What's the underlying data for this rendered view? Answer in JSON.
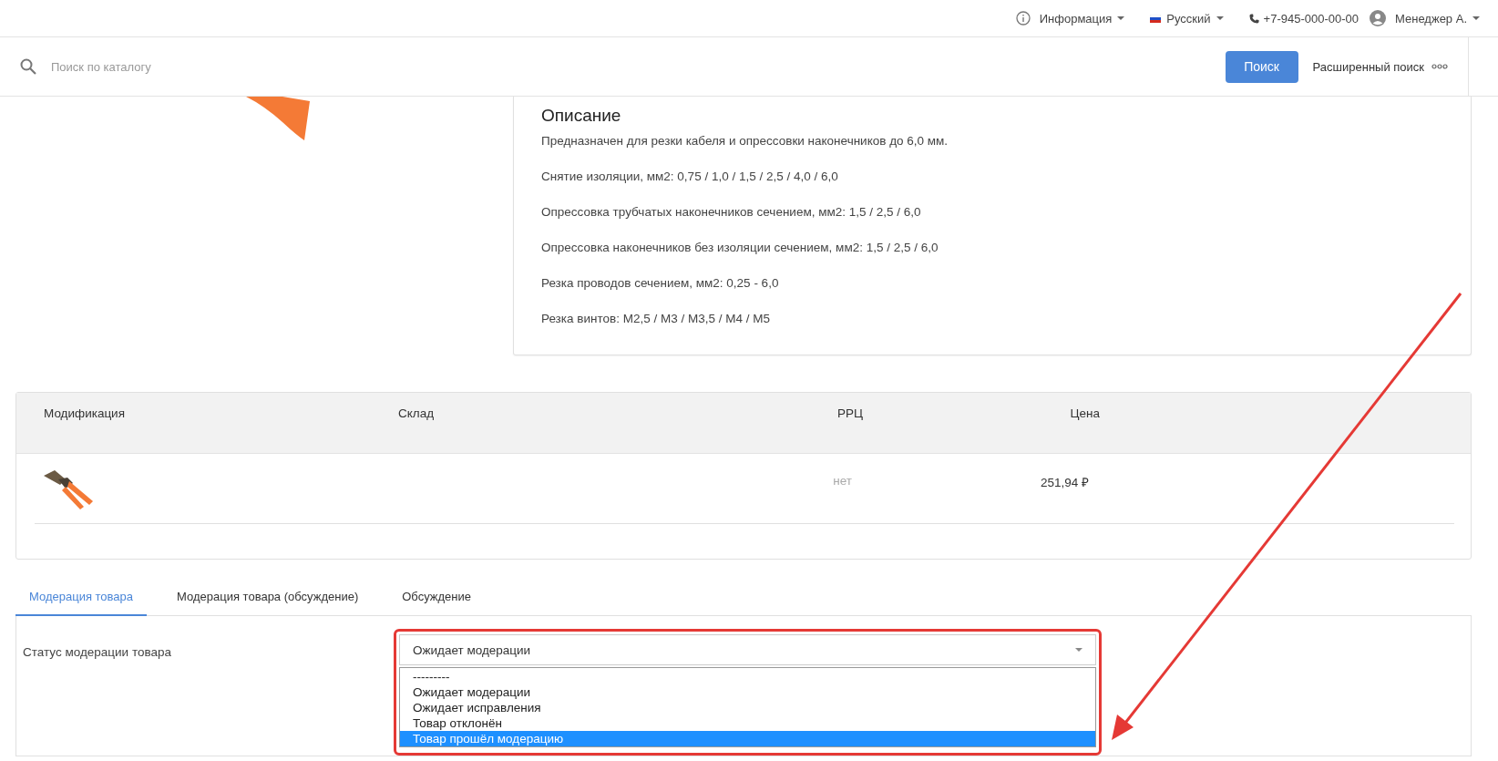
{
  "top_bar": {
    "info": "Информация",
    "language": "Русский",
    "phone": "+7-945-000-00-00",
    "user": "Менеджер А."
  },
  "search": {
    "placeholder": "Поиск по каталогу",
    "button": "Поиск",
    "advanced": "Расширенный поиск"
  },
  "description": {
    "title": "Описание",
    "lines": [
      "Предназначен для резки кабеля и опрессовки наконечников до 6,0 мм.",
      "Снятие изоляции, мм2: 0,75 / 1,0 / 1,5 / 2,5 / 4,0 / 6,0",
      "Опрессовка трубчатых наконечников сечением, мм2: 1,5 / 2,5 / 6,0",
      "Опрессовка наконечников без изоляции сечением, мм2: 1,5 / 2,5 / 6,0",
      "Резка проводов сечением, мм2: 0,25 - 6,0",
      "Резка винтов: М2,5 / М3 / М3,5 / М4 / М5"
    ]
  },
  "table": {
    "columns": [
      "Модификация",
      "Склад",
      "РРЦ",
      "Цена"
    ],
    "rows": [
      {
        "rrp": "нет",
        "price": "251,94 ₽"
      }
    ]
  },
  "tabs": [
    {
      "label": "Модерация товара",
      "selected": true
    },
    {
      "label": "Модерация товара (обсуждение)",
      "selected": false
    },
    {
      "label": "Обсуждение",
      "selected": false
    }
  ],
  "moderation": {
    "label": "Статус модерации товара",
    "value": "Ожидает модерации",
    "options": [
      {
        "label": "---------",
        "highlighted": false
      },
      {
        "label": "Ожидает модерации",
        "highlighted": false
      },
      {
        "label": "Ожидает исправления",
        "highlighted": false
      },
      {
        "label": "Товар отклонён",
        "highlighted": false
      },
      {
        "label": "Товар прошёл модерацию",
        "highlighted": true
      }
    ]
  }
}
